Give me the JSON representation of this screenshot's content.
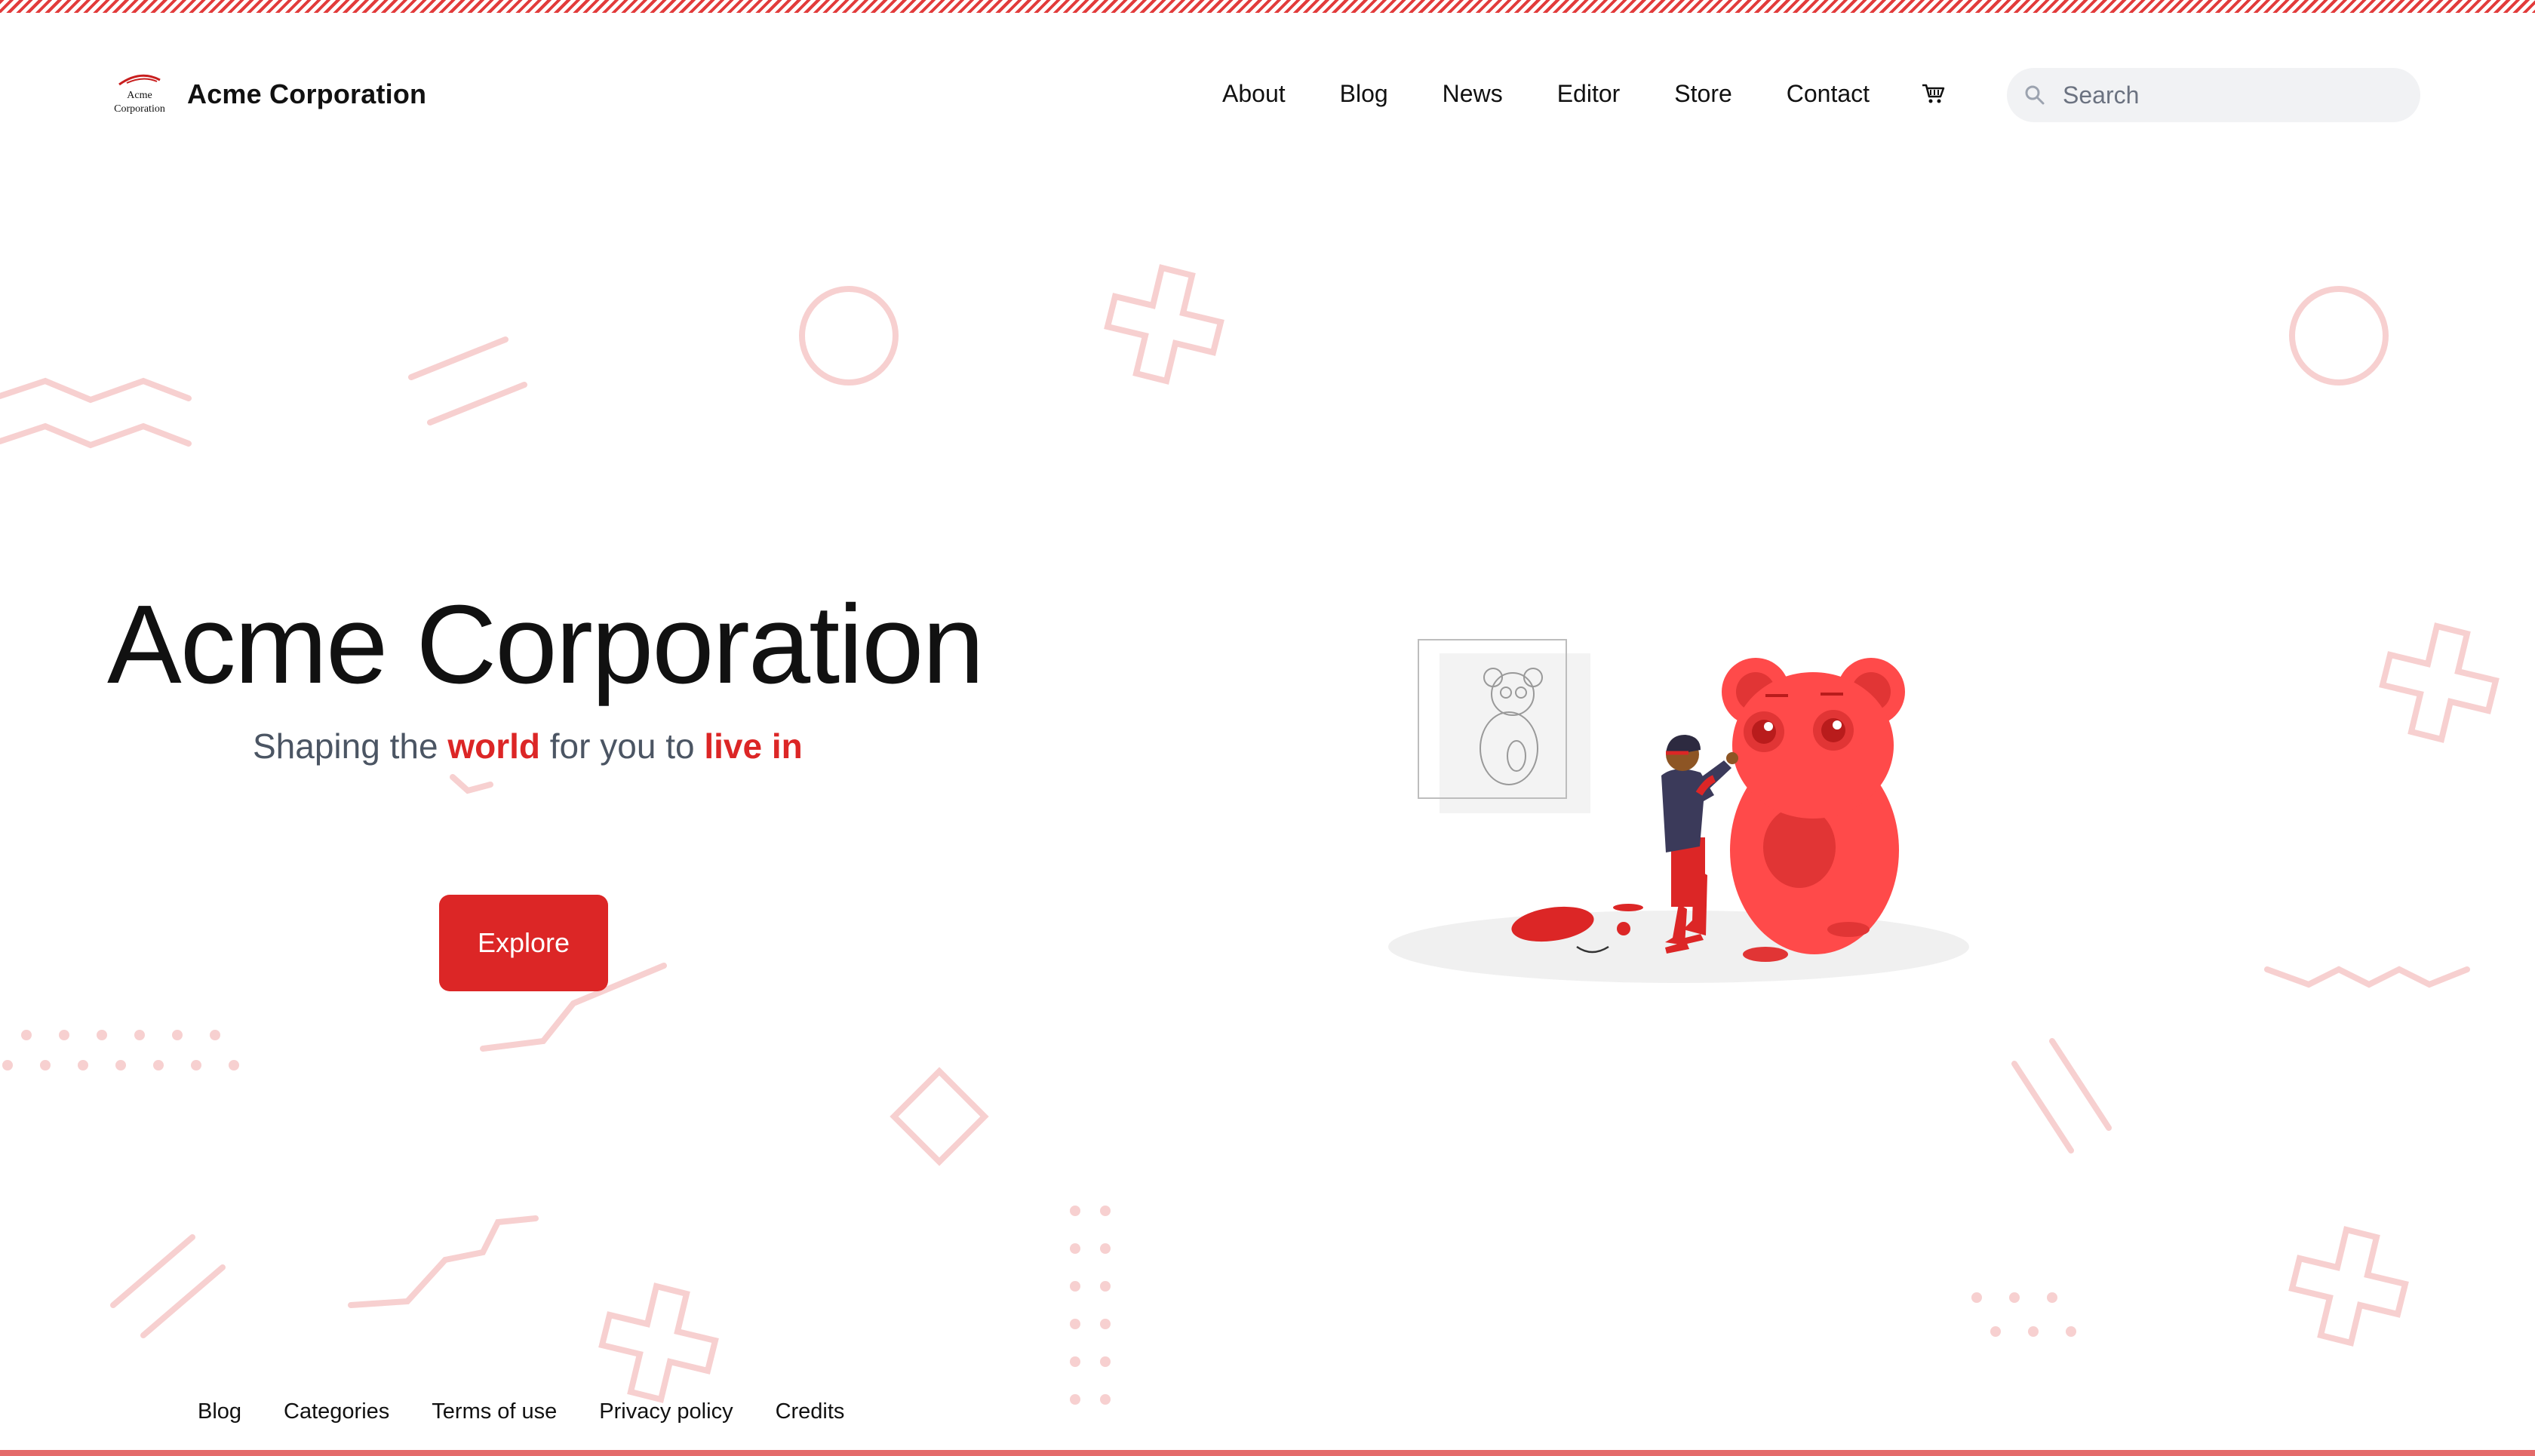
{
  "header": {
    "logo_text_line1": "Acme",
    "logo_text_line2": "Corporation",
    "brand_name": "Acme Corporation",
    "nav": [
      {
        "label": "About"
      },
      {
        "label": "Blog"
      },
      {
        "label": "News"
      },
      {
        "label": "Editor"
      },
      {
        "label": "Store"
      },
      {
        "label": "Contact"
      }
    ],
    "cart_icon": "cart-icon",
    "search": {
      "placeholder": "Search",
      "value": ""
    }
  },
  "hero": {
    "title": "Acme Corporation",
    "subtitle_part1": "Shaping the ",
    "subtitle_highlight1": "world",
    "subtitle_part2": " for you to ",
    "subtitle_highlight2": "live in",
    "cta_label": "Explore"
  },
  "footer": {
    "links": [
      {
        "label": "Blog"
      },
      {
        "label": "Categories"
      },
      {
        "label": "Terms of use"
      },
      {
        "label": "Privacy policy"
      },
      {
        "label": "Credits"
      }
    ]
  },
  "colors": {
    "accent": "#dc2626",
    "decor": "#f6c9c9",
    "stripe": "#e23b3b",
    "search_bg": "#f1f2f4"
  }
}
